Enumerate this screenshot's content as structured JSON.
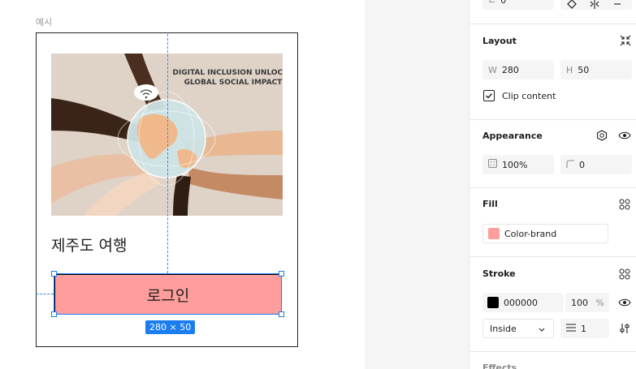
{
  "canvas": {
    "frame_label": "예시",
    "image_text_line1": "DIGITAL INCLUSION UNLOCKS",
    "image_text_line2": "GLOBAL SOCIAL IMPACT",
    "card_title": "제주도 여행",
    "button_label": "로그인",
    "size_badge": "280 × 50"
  },
  "panel": {
    "top_field_value": "0°",
    "layout": {
      "title": "Layout",
      "width_label": "W",
      "width_value": "280",
      "height_label": "H",
      "height_value": "50",
      "clip_content_label": "Clip content",
      "clip_content_checked": true
    },
    "appearance": {
      "title": "Appearance",
      "opacity_value": "100%",
      "corner_radius_value": "0"
    },
    "fill": {
      "title": "Fill",
      "style_name": "Color-brand",
      "color": "#ff9d9d"
    },
    "stroke": {
      "title": "Stroke",
      "hex_value": "000000",
      "opacity_value": "100",
      "opacity_unit": "%",
      "position_value": "Inside",
      "weight_value": "1",
      "color": "#000000"
    },
    "effects": {
      "title": "Effects"
    }
  }
}
